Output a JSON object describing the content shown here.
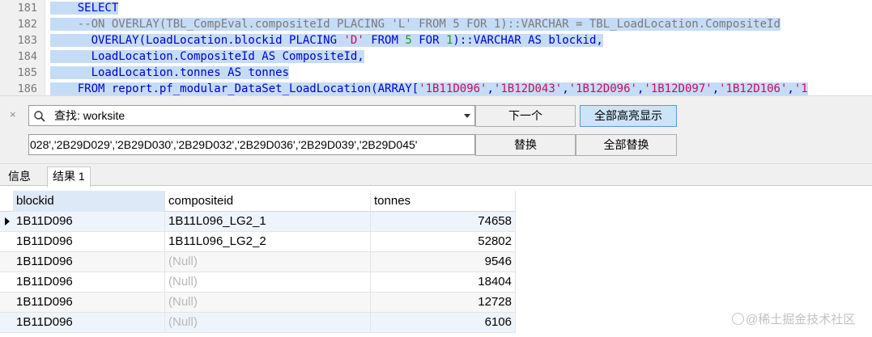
{
  "editor": {
    "line_numbers": [
      "181",
      "182",
      "183",
      "184",
      "185",
      "186"
    ],
    "lines": [
      [
        {
          "t": "    SELECT",
          "c": "kw"
        }
      ],
      [
        {
          "t": "    --ON OVERLAY(TBL_CompEval.compositeId PLACING 'L' FROM 5 FOR 1)::VARCHAR = TBL_LoadLocation.CompositeId",
          "c": "cm"
        }
      ],
      [
        {
          "t": "      OVERLAY(LoadLocation.blockid ",
          "c": "plain"
        },
        {
          "t": "PLACING",
          "c": "kw"
        },
        {
          "t": " ",
          "c": "plain"
        },
        {
          "t": "'D'",
          "c": "str"
        },
        {
          "t": " ",
          "c": "plain"
        },
        {
          "t": "FROM",
          "c": "kw"
        },
        {
          "t": " ",
          "c": "plain"
        },
        {
          "t": "5",
          "c": "num"
        },
        {
          "t": " ",
          "c": "plain"
        },
        {
          "t": "FOR",
          "c": "kw"
        },
        {
          "t": " ",
          "c": "plain"
        },
        {
          "t": "1",
          "c": "num"
        },
        {
          "t": ")::VARCHAR ",
          "c": "plain"
        },
        {
          "t": "AS",
          "c": "kw"
        },
        {
          "t": " blockid,",
          "c": "plain"
        }
      ],
      [
        {
          "t": "      LoadLocation.CompositeId ",
          "c": "plain"
        },
        {
          "t": "AS",
          "c": "kw"
        },
        {
          "t": " CompositeId,",
          "c": "plain"
        }
      ],
      [
        {
          "t": "      LoadLocation.tonnes ",
          "c": "plain"
        },
        {
          "t": "AS",
          "c": "kw"
        },
        {
          "t": " tonnes",
          "c": "plain"
        }
      ],
      [
        {
          "t": "    ",
          "c": "plain"
        },
        {
          "t": "FROM",
          "c": "kw"
        },
        {
          "t": " report.pf_modular_DataSet_LoadLocation(",
          "c": "plain"
        },
        {
          "t": "ARRAY",
          "c": "kw"
        },
        {
          "t": "[",
          "c": "plain"
        },
        {
          "t": "'1B11D096'",
          "c": "str"
        },
        {
          "t": ",",
          "c": "plain"
        },
        {
          "t": "'1B12D043'",
          "c": "str"
        },
        {
          "t": ",",
          "c": "plain"
        },
        {
          "t": "'1B12D096'",
          "c": "str"
        },
        {
          "t": ",",
          "c": "plain"
        },
        {
          "t": "'1B12D097'",
          "c": "str"
        },
        {
          "t": ",",
          "c": "plain"
        },
        {
          "t": "'1B12D106'",
          "c": "str"
        },
        {
          "t": ",",
          "c": "plain"
        },
        {
          "t": "'1",
          "c": "str"
        }
      ]
    ]
  },
  "findbar": {
    "close_glyph": "×",
    "find_value": "查找: worksite",
    "replace_value": "028','2B29D029','2B29D030','2B29D032','2B29D036','2B29D039','2B29D045'",
    "next_label": "下一个",
    "highlight_all_label": "全部高亮显示",
    "replace_label": "替换",
    "replace_all_label": "全部替换"
  },
  "tabs": {
    "info": "信息",
    "result": "结果 1"
  },
  "grid": {
    "columns": [
      "blockid",
      "compositeid",
      "tonnes"
    ],
    "null_text": "(Null)",
    "rows": [
      {
        "blockid": "1B11D096",
        "compositeid": "1B11L096_LG2_1",
        "tonnes": "74658"
      },
      {
        "blockid": "1B11D096",
        "compositeid": "1B11L096_LG2_2",
        "tonnes": "52802"
      },
      {
        "blockid": "1B11D096",
        "compositeid": null,
        "tonnes": "9546"
      },
      {
        "blockid": "1B11D096",
        "compositeid": null,
        "tonnes": "18404"
      },
      {
        "blockid": "1B11D096",
        "compositeid": null,
        "tonnes": "12728"
      },
      {
        "blockid": "1B11D096",
        "compositeid": null,
        "tonnes": "6106"
      }
    ]
  },
  "watermark": "@稀土掘金技术社区",
  "colors": {
    "selection": "#c5dcf6",
    "keyword": "#0000d8",
    "string": "#c8105a",
    "number": "#189e18",
    "comment": "#7a7a7a",
    "null": "#b8b8b8"
  }
}
